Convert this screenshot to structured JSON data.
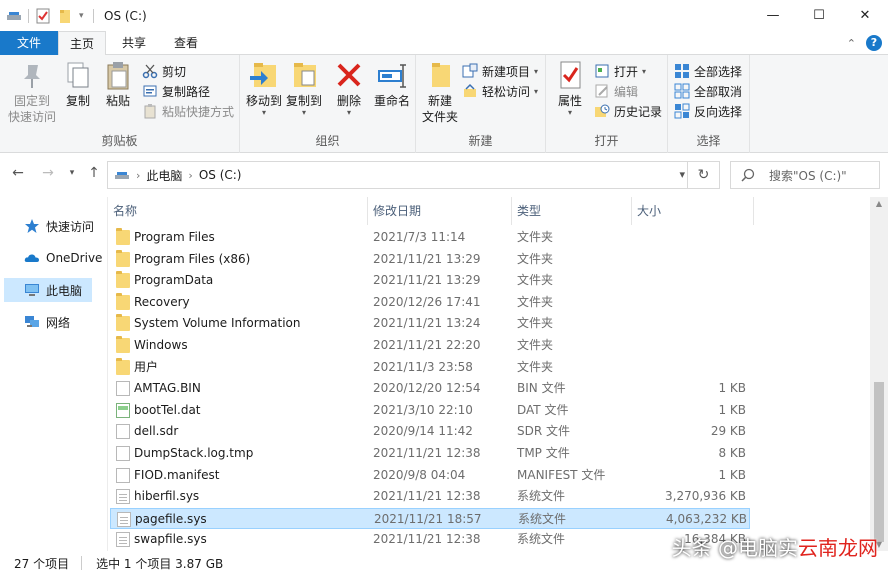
{
  "window": {
    "title": "OS (C:)",
    "minimize": "—",
    "maximize": "☐",
    "close": "✕"
  },
  "ribbon_tabs": {
    "file": "文件",
    "home": "主页",
    "share": "共享",
    "view": "查看"
  },
  "ribbon": {
    "clipboard": {
      "label": "剪贴板",
      "pin": "固定到\n快速访问",
      "copy": "复制",
      "paste": "粘贴",
      "cut": "剪切",
      "copy_path": "复制路径",
      "paste_shortcut": "粘贴快捷方式"
    },
    "organize": {
      "label": "组织",
      "move_to": "移动到",
      "copy_to": "复制到",
      "delete": "删除",
      "rename": "重命名"
    },
    "new": {
      "label": "新建",
      "new_folder": "新建\n文件夹",
      "new_item": "新建项目",
      "easy_access": "轻松访问"
    },
    "open": {
      "label": "打开",
      "properties": "属性",
      "open": "打开",
      "edit": "编辑",
      "history": "历史记录"
    },
    "select": {
      "label": "选择",
      "select_all": "全部选择",
      "select_none": "全部取消",
      "invert": "反向选择"
    }
  },
  "address": {
    "crumbs": [
      "此电脑",
      "OS (C:)"
    ],
    "search_placeholder": "搜索\"OS (C:)\""
  },
  "navpane": [
    {
      "label": "快速访问",
      "icon": "star-icon"
    },
    {
      "label": "OneDrive",
      "icon": "cloud-icon"
    },
    {
      "label": "此电脑",
      "icon": "computer-icon"
    },
    {
      "label": "网络",
      "icon": "network-icon"
    }
  ],
  "columns": {
    "name": "名称",
    "date": "修改日期",
    "type": "类型",
    "size": "大小"
  },
  "files": [
    {
      "name": "Program Files",
      "date": "2021/7/3 11:14",
      "type": "文件夹",
      "size": "",
      "kind": "folder"
    },
    {
      "name": "Program Files (x86)",
      "date": "2021/11/21 13:29",
      "type": "文件夹",
      "size": "",
      "kind": "folder"
    },
    {
      "name": "ProgramData",
      "date": "2021/11/21 13:29",
      "type": "文件夹",
      "size": "",
      "kind": "folder"
    },
    {
      "name": "Recovery",
      "date": "2020/12/26 17:41",
      "type": "文件夹",
      "size": "",
      "kind": "folder"
    },
    {
      "name": "System Volume Information",
      "date": "2021/11/21 13:24",
      "type": "文件夹",
      "size": "",
      "kind": "folder"
    },
    {
      "name": "Windows",
      "date": "2021/11/21 22:20",
      "type": "文件夹",
      "size": "",
      "kind": "folder"
    },
    {
      "name": "用户",
      "date": "2021/11/3 23:58",
      "type": "文件夹",
      "size": "",
      "kind": "folder"
    },
    {
      "name": "AMTAG.BIN",
      "date": "2020/12/20 12:54",
      "type": "BIN 文件",
      "size": "1 KB",
      "kind": "doc"
    },
    {
      "name": "bootTel.dat",
      "date": "2021/3/10 22:10",
      "type": "DAT 文件",
      "size": "1 KB",
      "kind": "dat"
    },
    {
      "name": "dell.sdr",
      "date": "2020/9/14 11:42",
      "type": "SDR 文件",
      "size": "29 KB",
      "kind": "doc"
    },
    {
      "name": "DumpStack.log.tmp",
      "date": "2021/11/21 12:38",
      "type": "TMP 文件",
      "size": "8 KB",
      "kind": "doc"
    },
    {
      "name": "FIOD.manifest",
      "date": "2020/9/8 04:04",
      "type": "MANIFEST 文件",
      "size": "1 KB",
      "kind": "doc"
    },
    {
      "name": "hiberfil.sys",
      "date": "2021/11/21 12:38",
      "type": "系统文件",
      "size": "3,270,936 KB",
      "kind": "sys"
    },
    {
      "name": "pagefile.sys",
      "date": "2021/11/21 18:57",
      "type": "系统文件",
      "size": "4,063,232 KB",
      "kind": "sys",
      "selected": true
    },
    {
      "name": "swapfile.sys",
      "date": "2021/11/21 12:38",
      "type": "系统文件",
      "size": "16,384 KB",
      "kind": "sys"
    }
  ],
  "status": {
    "count": "27 个项目",
    "selection": "选中 1 个项目 3.87 GB"
  },
  "watermark": {
    "prefix": "头条 @电脑实",
    "red": "云南龙网"
  },
  "colors": {
    "accent": "#1979ca",
    "selection": "#cce8ff",
    "folder": "#f8d775"
  }
}
